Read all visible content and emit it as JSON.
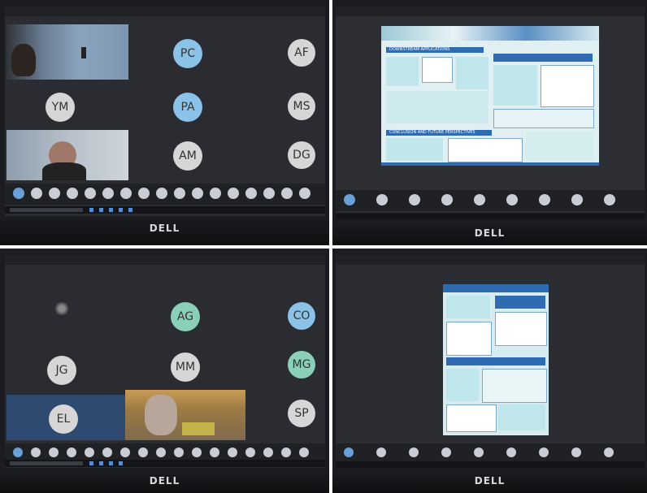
{
  "laptop_logo": "DELL",
  "panel_tl": {
    "avatars": [
      {
        "initials": "PC",
        "color": "#8ac2e8"
      },
      {
        "initials": "AF",
        "color": "#d6d6d6"
      },
      {
        "initials": "YM",
        "color": "#d6d6d6"
      },
      {
        "initials": "PA",
        "color": "#8ac2e8"
      },
      {
        "initials": "MS",
        "color": "#d6d6d6"
      },
      {
        "initials": "AM",
        "color": "#d6d6d6"
      },
      {
        "initials": "DG",
        "color": "#d6d6d6"
      }
    ]
  },
  "panel_tr": {
    "poster_sections": [
      "DOWNSTREAM APPLICATIONS",
      "CONCLUSION AND FUTURE PERSPECTIVES"
    ]
  },
  "panel_bl": {
    "avatars": [
      {
        "initials": "AG",
        "color": "#8ad0b8"
      },
      {
        "initials": "CO",
        "color": "#8ac2e8"
      },
      {
        "initials": "JG",
        "color": "#d6d6d6"
      },
      {
        "initials": "MM",
        "color": "#d6d6d6"
      },
      {
        "initials": "MG",
        "color": "#8ad0b8"
      },
      {
        "initials": "EL",
        "color": "#d6d6d6"
      },
      {
        "initials": "SP",
        "color": "#d6d6d6"
      }
    ]
  },
  "colors": {
    "screen_bg": "#2a2c31",
    "poster_teal": "#bfe6ea",
    "poster_blue": "#2f6bb0",
    "taskbar_icon": "#5b8ed0"
  }
}
